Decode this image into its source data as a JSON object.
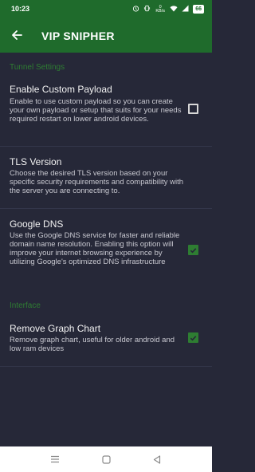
{
  "status_bar": {
    "time": "10:23",
    "battery": "66",
    "icons": [
      "alarm-icon",
      "vibrate-icon",
      "data-speed-icon",
      "wifi-icon",
      "signal-icon",
      "battery-icon"
    ],
    "data_speed": "0 KB/s"
  },
  "app_bar": {
    "title": "VIP SNIPHER"
  },
  "sections": {
    "tunnel_settings": "Tunnel Settings",
    "interface": "Interface"
  },
  "prefs": {
    "custom_payload": {
      "title": "Enable Custom Payload",
      "summary": "Enable to use custom payload so you can create your own payload or setup that suits for your needs required restart on lower android devices.",
      "checked": false
    },
    "tls_version": {
      "title": "TLS Version",
      "summary": "Choose the desired TLS version based on your specific security requirements and compatibility with the server you are connecting to."
    },
    "google_dns": {
      "title": "Google DNS",
      "summary": "Use the Google DNS service for faster and reliable domain name resolution. Enabling this option will improve your internet browsing experience by utilizing Google's optimized DNS infrastructure",
      "checked": true
    },
    "remove_graph": {
      "title": "Remove Graph Chart",
      "summary": "Remove graph chart, useful for older android and low ram devices",
      "checked": true
    }
  },
  "colors": {
    "primary": "#1f6b2c",
    "accent": "#2e7d32",
    "background": "#262838"
  }
}
